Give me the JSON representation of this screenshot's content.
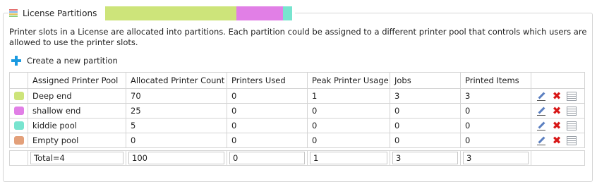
{
  "header": {
    "title": "License Partitions",
    "partition_bar": [
      {
        "color": "#cde47a",
        "fraction": 0.7
      },
      {
        "color": "#e17fe6",
        "fraction": 0.25
      },
      {
        "color": "#78e4cf",
        "fraction": 0.05
      }
    ]
  },
  "description": "Printer slots in a License are allocated into partitions. Each partition could be assigned to a different printer pool that controls which users are allowed to use the printer slots.",
  "create_label": "Create a new partition",
  "table": {
    "columns": [
      "Assigned Printer Pool",
      "Allocated Printer Count",
      "Printers Used",
      "Peak Printer Usage",
      "Jobs",
      "Printed Items"
    ],
    "rows": [
      {
        "color": "#cde47a",
        "pool": "Deep end",
        "allocated": "70",
        "used": "0",
        "peak": "1",
        "jobs": "3",
        "items": "3"
      },
      {
        "color": "#e17fe6",
        "pool": "shallow end",
        "allocated": "25",
        "used": "0",
        "peak": "0",
        "jobs": "0",
        "items": "0"
      },
      {
        "color": "#78e4cf",
        "pool": "kiddie pool",
        "allocated": "5",
        "used": "0",
        "peak": "0",
        "jobs": "0",
        "items": "0"
      },
      {
        "color": "#e3a07a",
        "pool": "Empty pool",
        "allocated": "0",
        "used": "0",
        "peak": "0",
        "jobs": "0",
        "items": "0"
      }
    ],
    "totals": {
      "pool": "Total=4",
      "allocated": "100",
      "used": "0",
      "peak": "1",
      "jobs": "3",
      "items": "3"
    }
  }
}
